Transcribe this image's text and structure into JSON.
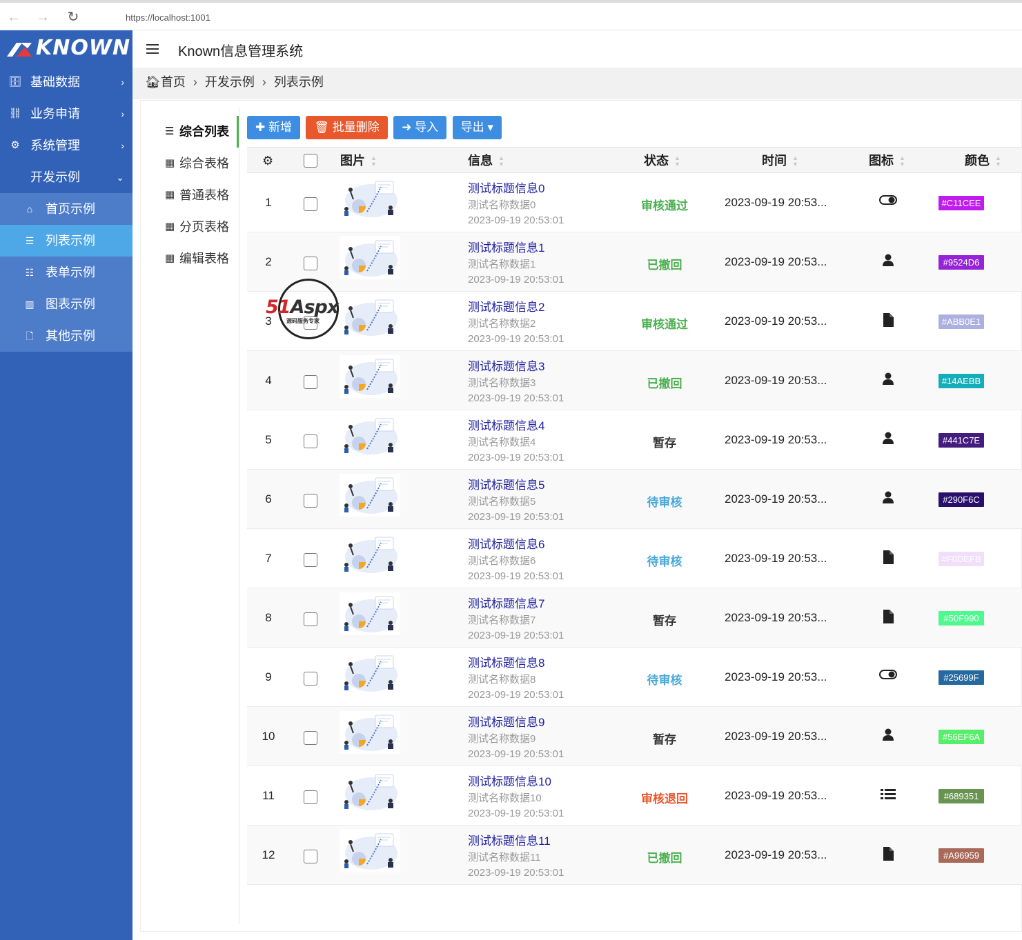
{
  "browser": {
    "url": "https://localhost:1001"
  },
  "logo": {
    "text": "KNOWN"
  },
  "sidebar": {
    "items": [
      {
        "label": "基础数据",
        "icon": "database-icon",
        "arrow": "›"
      },
      {
        "label": "业务申请",
        "icon": "sitemap-icon",
        "arrow": "›"
      },
      {
        "label": "系统管理",
        "icon": "gears-icon",
        "arrow": "›"
      },
      {
        "label": "开发示例",
        "icon": "code-icon",
        "arrow": "⌄"
      }
    ],
    "sub_items": [
      {
        "label": "首页示例",
        "icon": "home-icon"
      },
      {
        "label": "列表示例",
        "icon": "list-icon"
      },
      {
        "label": "表单示例",
        "icon": "th-list-icon"
      },
      {
        "label": "图表示例",
        "icon": "bar-chart-icon"
      },
      {
        "label": "其他示例",
        "icon": "file-icon"
      }
    ]
  },
  "header": {
    "title": "Known信息管理系统"
  },
  "breadcrumb": [
    "首页",
    "开发示例",
    "列表示例"
  ],
  "tree": [
    {
      "label": "综合列表",
      "icon": "list-icon"
    },
    {
      "label": "综合表格",
      "icon": "table-icon"
    },
    {
      "label": "普通表格",
      "icon": "table-icon"
    },
    {
      "label": "分页表格",
      "icon": "table-icon"
    },
    {
      "label": "编辑表格",
      "icon": "table-icon"
    }
  ],
  "toolbar": {
    "add": "新增",
    "batch_delete": "批量删除",
    "import": "导入",
    "export": "导出"
  },
  "table": {
    "headers": {
      "image": "图片",
      "info": "信息",
      "status": "状态",
      "time": "时间",
      "icon": "图标",
      "color": "颜色"
    },
    "rows": [
      {
        "no": "1",
        "title": "测试标题信息0",
        "name": "测试名称数据0",
        "date": "2023-09-19 20:53:01",
        "status": "审核通过",
        "status_color": "#4caf50",
        "time": "2023-09-19 20:53...",
        "icon": "toggle-icon",
        "color": "#C11CEE"
      },
      {
        "no": "2",
        "title": "测试标题信息1",
        "name": "测试名称数据1",
        "date": "2023-09-19 20:53:01",
        "status": "已撤回",
        "status_color": "#4caf50",
        "time": "2023-09-19 20:53...",
        "icon": "user-icon",
        "color": "#9524D6"
      },
      {
        "no": "3",
        "title": "测试标题信息2",
        "name": "测试名称数据2",
        "date": "2023-09-19 20:53:01",
        "status": "审核通过",
        "status_color": "#4caf50",
        "time": "2023-09-19 20:53...",
        "icon": "file-icon",
        "color": "#ABB0E1"
      },
      {
        "no": "4",
        "title": "测试标题信息3",
        "name": "测试名称数据3",
        "date": "2023-09-19 20:53:01",
        "status": "已撤回",
        "status_color": "#4caf50",
        "time": "2023-09-19 20:53...",
        "icon": "user-icon",
        "color": "#14AEBB"
      },
      {
        "no": "5",
        "title": "测试标题信息4",
        "name": "测试名称数据4",
        "date": "2023-09-19 20:53:01",
        "status": "暂存",
        "status_color": "#333333",
        "time": "2023-09-19 20:53...",
        "icon": "user-icon",
        "color": "#441C7E"
      },
      {
        "no": "6",
        "title": "测试标题信息5",
        "name": "测试名称数据5",
        "date": "2023-09-19 20:53:01",
        "status": "待审核",
        "status_color": "#4aa8d8",
        "time": "2023-09-19 20:53...",
        "icon": "user-icon",
        "color": "#290F6C"
      },
      {
        "no": "7",
        "title": "测试标题信息6",
        "name": "测试名称数据6",
        "date": "2023-09-19 20:53:01",
        "status": "待审核",
        "status_color": "#4aa8d8",
        "time": "2023-09-19 20:53...",
        "icon": "file-icon",
        "color": "#F0DEFB"
      },
      {
        "no": "8",
        "title": "测试标题信息7",
        "name": "测试名称数据7",
        "date": "2023-09-19 20:53:01",
        "status": "暂存",
        "status_color": "#333333",
        "time": "2023-09-19 20:53...",
        "icon": "file-icon",
        "color": "#50F990"
      },
      {
        "no": "9",
        "title": "测试标题信息8",
        "name": "测试名称数据8",
        "date": "2023-09-19 20:53:01",
        "status": "待审核",
        "status_color": "#4aa8d8",
        "time": "2023-09-19 20:53...",
        "icon": "toggle-icon",
        "color": "#25699F"
      },
      {
        "no": "10",
        "title": "测试标题信息9",
        "name": "测试名称数据9",
        "date": "2023-09-19 20:53:01",
        "status": "暂存",
        "status_color": "#333333",
        "time": "2023-09-19 20:53...",
        "icon": "user-icon",
        "color": "#56EF6A"
      },
      {
        "no": "11",
        "title": "测试标题信息10",
        "name": "测试名称数据10",
        "date": "2023-09-19 20:53:01",
        "status": "审核退回",
        "status_color": "#e8582c",
        "time": "2023-09-19 20:53...",
        "icon": "list-icon",
        "color": "#689351"
      },
      {
        "no": "12",
        "title": "测试标题信息11",
        "name": "测试名称数据11",
        "date": "2023-09-19 20:53:01",
        "status": "已撤回",
        "status_color": "#4caf50",
        "time": "2023-09-19 20:53...",
        "icon": "file-icon",
        "color": "#A96959"
      }
    ]
  },
  "watermark": {
    "brand_red": "51",
    "brand_dark": "Aspx",
    "tagline": "源码服务专家"
  },
  "theme": {
    "sidebar": "#3262b7",
    "submenu": "#4d7cc9",
    "active": "#4ea7e6",
    "primary": "#3d8de3",
    "danger": "#e8582c"
  }
}
